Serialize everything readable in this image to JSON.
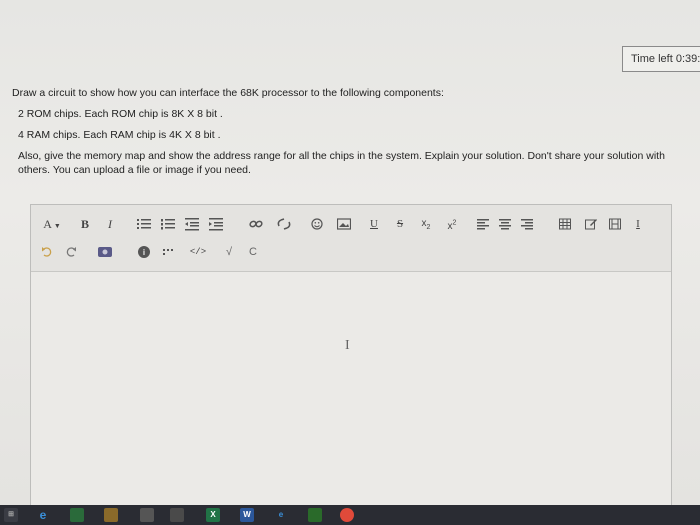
{
  "timer": {
    "text": "Time left 0:39:"
  },
  "question": {
    "intro": "Draw a circuit to show how you can interface the 68K processor to the following components:",
    "rom": "2 ROM chips. Each ROM chip is 8K X 8 bit .",
    "ram": "4 RAM chips. Each RAM chip is 4K X 8 bit .",
    "instructions": "Also, give the memory map and show the address range for all the chips in the system. Explain your solution. Don't share your solution with others. You can upload a file or image if you need."
  },
  "toolbar": {
    "font_label": "A",
    "bold_label": "B",
    "italic_label": "I",
    "underline_label": "U",
    "strike_label": "S",
    "subscript_label": "x",
    "subscript_mark": "2",
    "superscript_label": "x",
    "superscript_mark": "2",
    "html_label": "</>",
    "check_label": "√",
    "spell_label": "C",
    "more_label": "I",
    "icons": [
      "font-dropdown-icon",
      "bold-icon",
      "italic-icon",
      "unordered-list-icon",
      "ordered-list-icon",
      "outdent-icon",
      "indent-icon",
      "link-icon",
      "unlink-icon",
      "emoji-icon",
      "image-icon",
      "underline-icon",
      "strikethrough-icon",
      "subscript-icon",
      "superscript-icon",
      "align-left-icon",
      "align-center-icon",
      "align-right-icon",
      "table-icon",
      "edit-icon",
      "media-icon",
      "clear-format-icon",
      "undo-icon",
      "redo-icon",
      "record-icon",
      "info-icon",
      "accessibility-icon",
      "html-icon",
      "equation-icon",
      "spellcheck-icon"
    ]
  },
  "editor": {
    "cursor": "I"
  },
  "colors": {
    "background": "#e6e6e3",
    "taskbar": "#2a2c33",
    "text": "#222222",
    "icon_gray": "#5a5a5a"
  }
}
